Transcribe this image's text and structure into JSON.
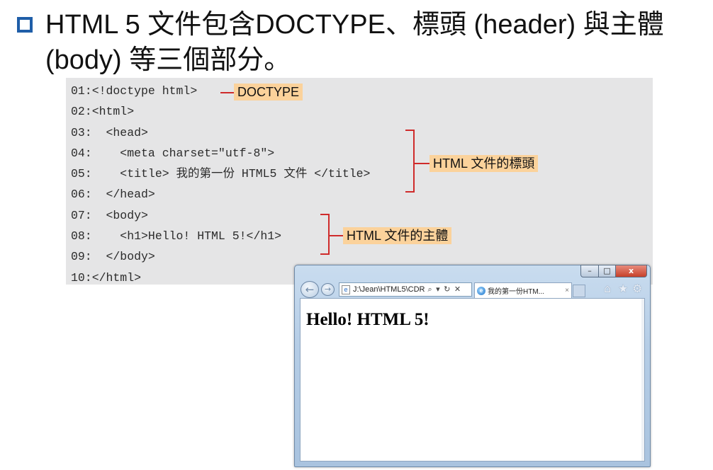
{
  "slide": {
    "title": "HTML 5 文件包含DOCTYPE、標頭 (header) 與主體 (body) 等三個部分。"
  },
  "code": {
    "lines": [
      "01:<!doctype html>",
      "02:<html>",
      "03:  <head>",
      "04:    <meta charset=\"utf-8\">",
      "05:    <title> 我的第一份 HTML5 文件 </title>",
      "06:  </head>",
      "07:  <body>",
      "08:    <h1>Hello! HTML 5!</h1>",
      "09:  </body>",
      "10:</html>"
    ]
  },
  "annotations": {
    "doctype": "DOCTYPE",
    "head": "HTML 文件的標頭",
    "body": "HTML 文件的主體"
  },
  "browser": {
    "address": "J:\\Jean\\HTML5\\CDR",
    "address_tools": "⌕ ▾ ↻ ✕",
    "tab_title": "我的第一份HTM...",
    "tab_close": "×",
    "window_buttons": {
      "minimize": "–",
      "maximize": "□",
      "close": "x"
    },
    "icons": {
      "back": "←",
      "forward": "→",
      "home": "⌂",
      "favorites": "★",
      "tools": "⚙",
      "page": "e",
      "ie": "e"
    },
    "page_heading": "Hello! HTML 5!"
  },
  "colors": {
    "bullet": "#1f5ea8",
    "code_bg": "#e5e5e6",
    "annotation_bg": "#fbd29b",
    "bracket": "#cf2b2b"
  }
}
